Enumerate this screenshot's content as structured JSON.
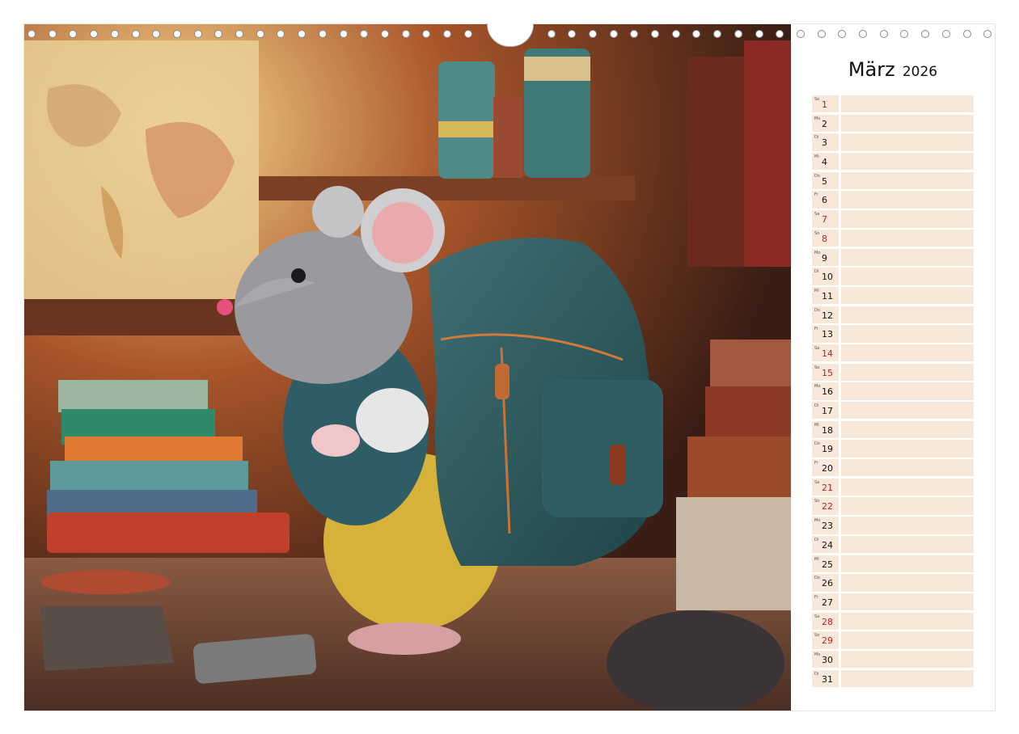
{
  "calendar": {
    "month": "März",
    "year": "2026",
    "days": [
      {
        "abbr": "So",
        "num": "1",
        "weekend": "sun"
      },
      {
        "abbr": "Mo",
        "num": "2",
        "weekend": ""
      },
      {
        "abbr": "Di",
        "num": "3",
        "weekend": ""
      },
      {
        "abbr": "Mi",
        "num": "4",
        "weekend": ""
      },
      {
        "abbr": "Do",
        "num": "5",
        "weekend": ""
      },
      {
        "abbr": "Fr",
        "num": "6",
        "weekend": ""
      },
      {
        "abbr": "Sa",
        "num": "7",
        "weekend": "sat"
      },
      {
        "abbr": "So",
        "num": "8",
        "weekend": "sun"
      },
      {
        "abbr": "Mo",
        "num": "9",
        "weekend": ""
      },
      {
        "abbr": "Di",
        "num": "10",
        "weekend": ""
      },
      {
        "abbr": "Mi",
        "num": "11",
        "weekend": ""
      },
      {
        "abbr": "Do",
        "num": "12",
        "weekend": ""
      },
      {
        "abbr": "Fr",
        "num": "13",
        "weekend": ""
      },
      {
        "abbr": "Sa",
        "num": "14",
        "weekend": "sat"
      },
      {
        "abbr": "So",
        "num": "15",
        "weekend": "sun"
      },
      {
        "abbr": "Mo",
        "num": "16",
        "weekend": ""
      },
      {
        "abbr": "Di",
        "num": "17",
        "weekend": ""
      },
      {
        "abbr": "Mi",
        "num": "18",
        "weekend": ""
      },
      {
        "abbr": "Do",
        "num": "19",
        "weekend": ""
      },
      {
        "abbr": "Fr",
        "num": "20",
        "weekend": ""
      },
      {
        "abbr": "Sa",
        "num": "21",
        "weekend": "sat"
      },
      {
        "abbr": "So",
        "num": "22",
        "weekend": "sun"
      },
      {
        "abbr": "Mo",
        "num": "23",
        "weekend": ""
      },
      {
        "abbr": "Di",
        "num": "24",
        "weekend": ""
      },
      {
        "abbr": "Mi",
        "num": "25",
        "weekend": ""
      },
      {
        "abbr": "Do",
        "num": "26",
        "weekend": ""
      },
      {
        "abbr": "Fr",
        "num": "27",
        "weekend": ""
      },
      {
        "abbr": "Sa",
        "num": "28",
        "weekend": "sat"
      },
      {
        "abbr": "So",
        "num": "29",
        "weekend": "sun"
      },
      {
        "abbr": "Mo",
        "num": "30",
        "weekend": ""
      },
      {
        "abbr": "Di",
        "num": "31",
        "weekend": ""
      }
    ]
  },
  "colors": {
    "cell_fill": "#f7e8d9",
    "weekend_text": "#c02020"
  },
  "illustration": {
    "subject": "mouse-with-backpack"
  }
}
